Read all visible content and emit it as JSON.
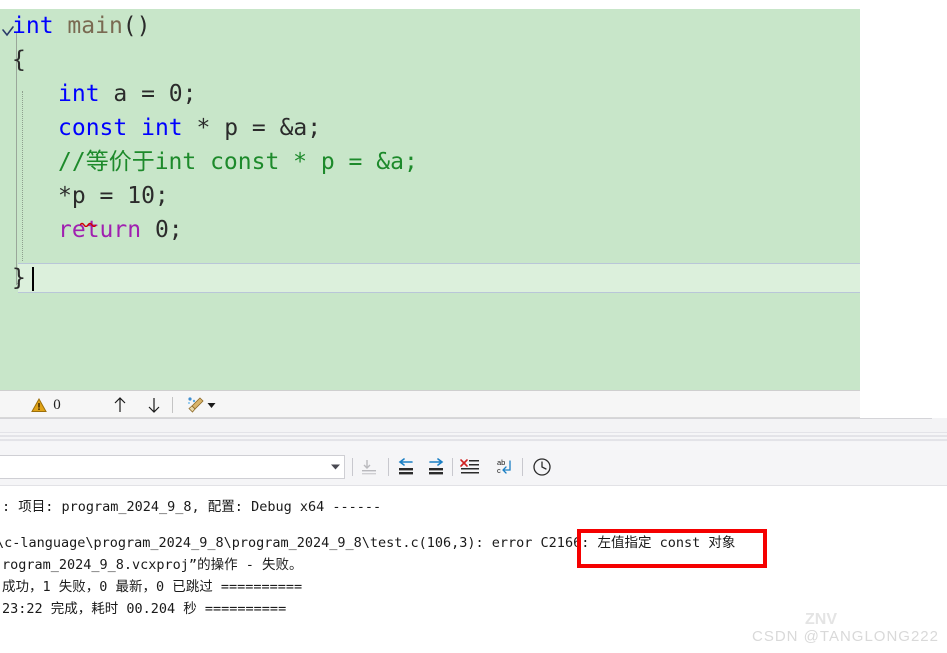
{
  "editor": {
    "lines": [
      {
        "indent": 0,
        "tokens": [
          {
            "t": "int",
            "c": "kw-blue"
          },
          {
            "t": " ",
            "c": "plain"
          },
          {
            "t": "main",
            "c": "fnname"
          },
          {
            "t": "()",
            "c": "plain"
          }
        ]
      },
      {
        "indent": 0,
        "tokens": [
          {
            "t": "{",
            "c": "plain"
          }
        ]
      },
      {
        "indent": 1,
        "tokens": [
          {
            "t": "int",
            "c": "kw-blue"
          },
          {
            "t": " a = 0;",
            "c": "plain"
          }
        ]
      },
      {
        "indent": 1,
        "tokens": [
          {
            "t": "const",
            "c": "kw-blue"
          },
          {
            "t": " ",
            "c": "plain"
          },
          {
            "t": "int",
            "c": "kw-blue"
          },
          {
            "t": " * p = &a;",
            "c": "plain"
          }
        ]
      },
      {
        "indent": 1,
        "tokens": [
          {
            "t": "//等价于int const * p = &a;",
            "c": "comment"
          }
        ]
      },
      {
        "indent": 1,
        "tokens": [
          {
            "t": "*p = 10;",
            "c": "plain"
          }
        ]
      },
      {
        "indent": 1,
        "tokens": [
          {
            "t": "return",
            "c": "kw-purple"
          },
          {
            "t": " 0;",
            "c": "plain"
          }
        ]
      }
    ],
    "current_line_text": "}",
    "background_color": "#c8e6c9",
    "keyword_color": "#0000ff",
    "comment_color": "#1d8a2b",
    "return_keyword_color": "#a020b0",
    "squiggle_color": "#d00000"
  },
  "nav_toolbar": {
    "warning_count": "0",
    "warning_icon": "warning-triangle-icon",
    "prev_icon": "arrow-up-icon",
    "next_icon": "arrow-down-icon",
    "clean_icon": "broom-icon",
    "clean_dropdown_icon": "chevron-down-icon"
  },
  "output": {
    "combo_value": "",
    "combo_placeholder": "",
    "combo_arrow_icon": "chevron-down-icon",
    "buttons": [
      {
        "name": "go-to-source-icon",
        "label": "转到源位置"
      },
      {
        "name": "navigate-back-icon",
        "label": "后退"
      },
      {
        "name": "navigate-forward-icon",
        "label": "前进"
      },
      {
        "name": "clear-all-icon",
        "label": "全部清除"
      },
      {
        "name": "word-wrap-icon",
        "label": "自动换行"
      },
      {
        "name": "toggle-timestamp-icon",
        "label": "显示时间戳"
      }
    ],
    "lines": [
      ": 项目: program_2024_9_8, 配置: Debug x64 ------",
      "",
      "\\c-language\\program_2024_9_8\\program_2024_9_8\\test.c(106,3): error C2166: 左值指定 const 对象",
      "rogram_2024_9_8.vcxproj”的操作 - 失败。",
      "成功，1 失败，0 最新，0 已跳过 ==========",
      "23:22 完成，耗时 00.204 秒 =========="
    ]
  },
  "annotation": {
    "error_box_color": "#f50000",
    "highlighted_text": "左值指定 const 对象"
  },
  "watermark": {
    "text": "CSDN @TANGLONG222",
    "mark": "ZNV"
  }
}
